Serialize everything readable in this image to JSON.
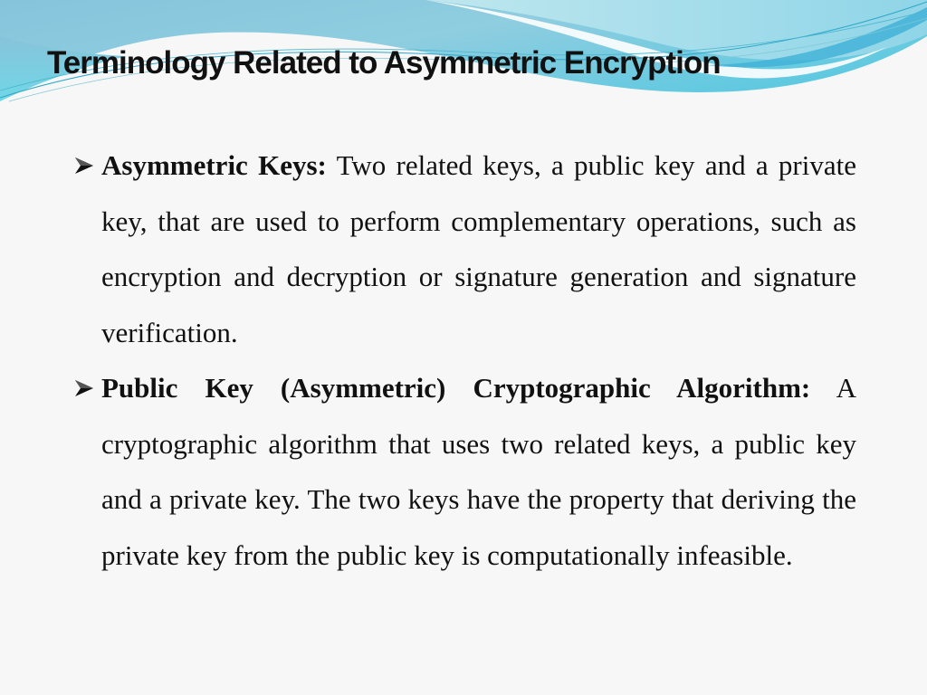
{
  "slide": {
    "title": "Terminology Related to Asymmetric Encryption",
    "colors": {
      "background": "#f7f7f7",
      "wave_light": "#a8dde6",
      "wave_dark": "#4fb8d8",
      "text": "#111111"
    },
    "bullets": [
      {
        "icon": "arrow-bullet-icon",
        "term": "Asymmetric Keys:",
        "definition": "Two related keys, a public key and a private key, that are used to perform complementary operations, such as encryption and decryption or signature generation and signature verification."
      },
      {
        "icon": "arrow-bullet-icon",
        "term": "Public Key (Asymmetric) Cryptographic Algorithm:",
        "definition": "A cryptographic algorithm that uses two related keys, a public key and a private key. The two keys have the property that deriving the private key from the public key is computationally infeasible."
      }
    ]
  }
}
